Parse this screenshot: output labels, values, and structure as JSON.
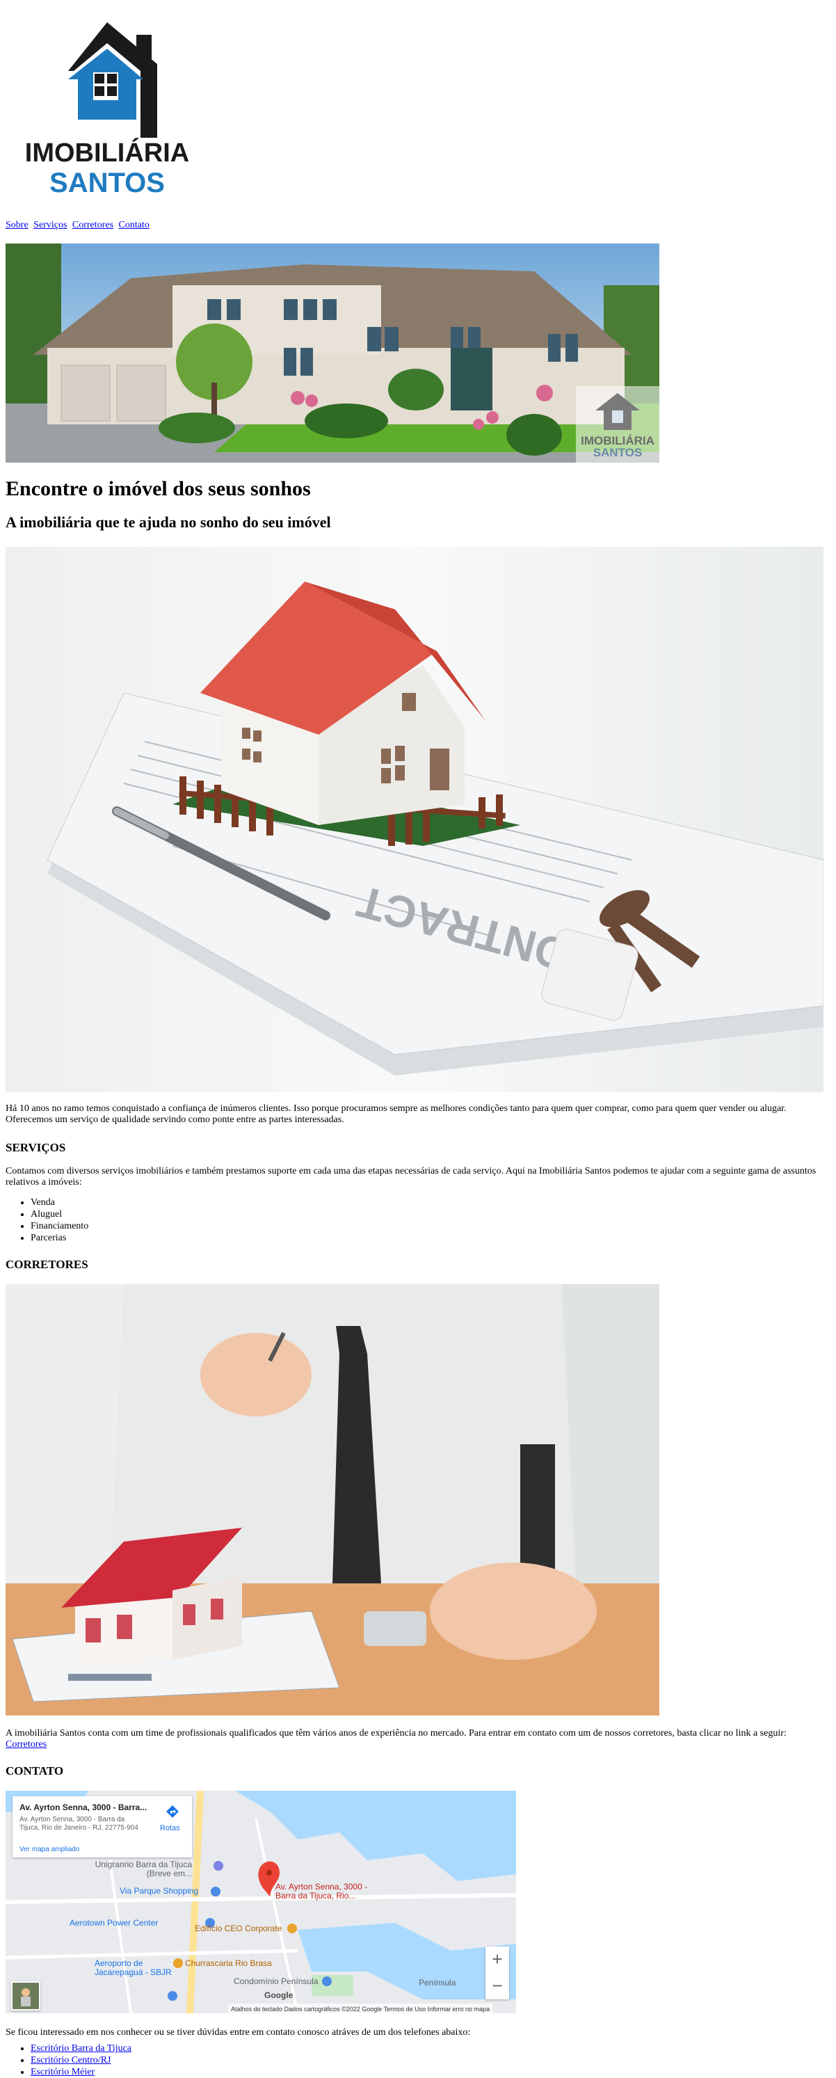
{
  "logo": {
    "line1": "IMOBILIÁRIA",
    "line2": "SANTOS"
  },
  "nav": {
    "sobre": "Sobre",
    "servicos": "Serviços",
    "corretores": "Corretores",
    "contato": "Contato"
  },
  "hero": {
    "watermark_line1": "IMOBILIÁRIA",
    "watermark_line2": "SANTOS"
  },
  "headline": "Encontre o imóvel dos seus sonhos",
  "subheadline": "A imobiliária que te ajuda no sonho do seu imóvel",
  "intro_text": "Há 10 anos no ramo temos conquistado a confiança de inúmeros clientes. Isso porque procuramos sempre as melhores condições tanto para quem quer comprar, como para quem quer vender ou alugar. Oferecemos um serviço de qualidade servindo como ponte entre as partes interessadas.",
  "servicos": {
    "title": "SERVIÇOS",
    "text": "Contamos com diversos serviços imobiliários e também prestamos suporte em cada uma das etapas necessárias de cada serviço. Aqui na Imobiliária Santos podemos te ajudar com a seguinte gama de assuntos relativos a imóveis:",
    "items": [
      "Venda",
      "Aluguel",
      "Financiamento",
      "Parcerias"
    ]
  },
  "corretores": {
    "title": "CORRETORES",
    "text": "A imobiliária Santos conta com um time de profissionais qualificados que têm vários anos de experiência no mercado. Para entrar em contato com um de nossos corretores, basta clicar no link a seguir:",
    "link": "Corretores"
  },
  "contato": {
    "title": "CONTATO",
    "map": {
      "card_title": "Av. Ayrton Senna, 3000 - Barra...",
      "card_address": "Av. Ayrton Senna, 3000 - Barra da Tijuca, Rio de Janeiro - RJ, 22775-904",
      "rotas": "Rotas",
      "ver_mapa": "Ver mapa ampliado",
      "pin_label": "Av. Ayrton Senna, 3000 - Barra da Tijuca, Rio...",
      "places": {
        "unigranrio": "Unigranrio Barra da Tijuca (Breve em...",
        "via_parque": "Via Parque Shopping",
        "aerotown": "Aerotown Power Center",
        "edificio_ceo": "Edifício CEO Corporate",
        "aeroporto": "Aeroporto de Jacarepaguá - SBJR",
        "churrascaria": "Churrascaria Rio Brasa",
        "condominio": "Condomínio Península",
        "peninsula": "Península",
        "google": "Google"
      },
      "footer": "Atalhos do teclado   Dados cartográficos ©2022 Google   Termos de Uso   Informar erro no mapa",
      "zoom_in": "+",
      "zoom_out": "−"
    },
    "text": "Se ficou interessado em nos conhecer ou se tiver dúvidas entre em contato conosco atráves de um dos telefones abaixo:",
    "escritorios": [
      "Escritório Barra da Tijuca",
      "Escritório Centro/RJ",
      "Escritório Méier"
    ]
  }
}
